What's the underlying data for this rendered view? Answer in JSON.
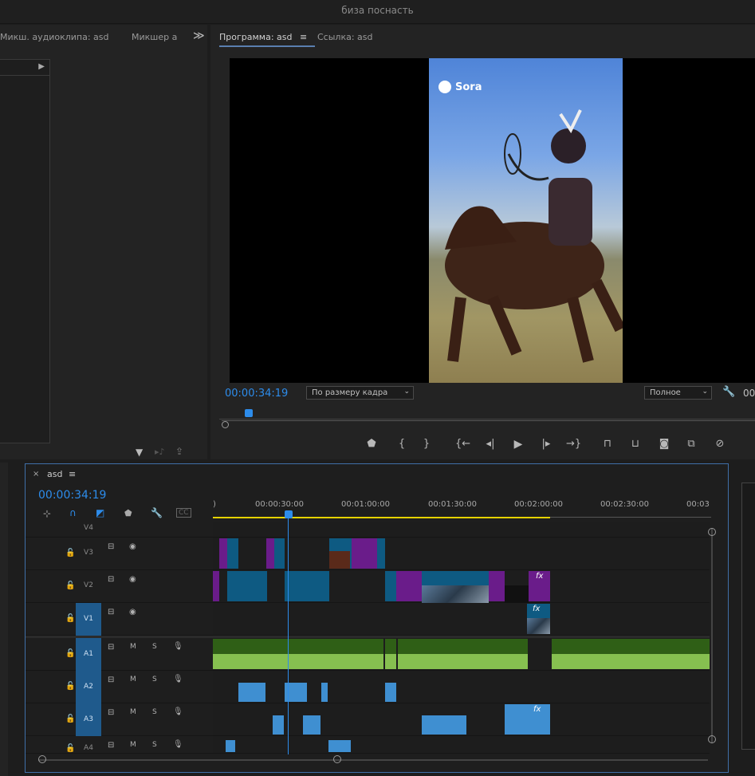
{
  "window": {
    "title": "биза поснасть"
  },
  "left_panel": {
    "tab_audio_clip_mixer": "Микш. аудиоклипа: asd",
    "tab_audio_mixer": "Микшер а",
    "overflow": "≫"
  },
  "program_monitor": {
    "tab_program": "Программа: asd",
    "tab_program_menu": "≡",
    "tab_reference": "Ссылка: asd",
    "watermark": "Sora",
    "timecode": "00:00:34:19",
    "fit_select": "По размеру кадра",
    "quality_select": "Полное",
    "extra": "00",
    "controls": [
      "add-marker",
      "mark-in",
      "mark-out",
      "go-to-in",
      "step-back",
      "play",
      "step-forward",
      "go-to-out",
      "lift",
      "extract",
      "export-frame",
      "compare-view",
      "button-editor"
    ]
  },
  "timeline": {
    "close": "×",
    "sequence_name": "asd",
    "menu": "≡",
    "timecode": "00:00:34:19",
    "ruler": [
      ")",
      "00:00:30:00",
      "00:01:00:00",
      "00:01:30:00",
      "00:02:00:00",
      "00:02:30:00",
      "00:03"
    ],
    "tracks": [
      {
        "name": "V4"
      },
      {
        "name": "V3"
      },
      {
        "name": "V2"
      },
      {
        "name": "V1"
      },
      {
        "name": "A1",
        "m": "M",
        "s": "S"
      },
      {
        "name": "A2",
        "m": "M",
        "s": "S"
      },
      {
        "name": "A3",
        "m": "M",
        "s": "S"
      },
      {
        "name": "A4",
        "m": "M",
        "s": "S"
      }
    ],
    "fx_label": "fx"
  },
  "colors": {
    "accent": "#2d8ceb",
    "video_clip": "#0e5a82",
    "purple_clip": "#6a1c8a",
    "audio_clip": "#4e8f2e",
    "audio_blue": "#3f8fd1",
    "work_area": "#e5d200"
  }
}
